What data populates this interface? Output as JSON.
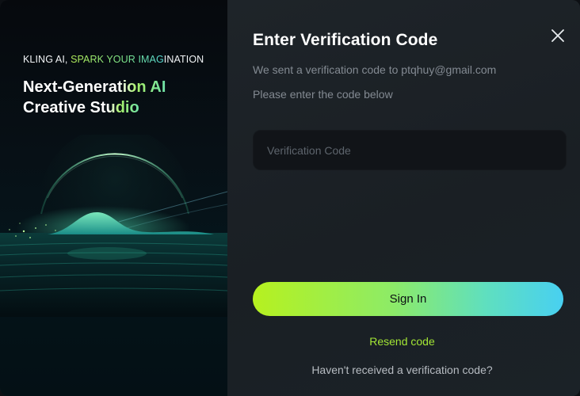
{
  "promo": {
    "tagline_part1": "KLING AI, ",
    "tagline_part2": "SPARK YOUR IMAG",
    "tagline_part3": "INATION",
    "headline_line1_plain": "Next-Gen",
    "headline_line1_grad": "eration AI",
    "headline_line2_plain": "Creative ",
    "headline_line2_grad": "Studio"
  },
  "dialog": {
    "title": "Enter Verification Code",
    "subtitle": "We sent a verification code to ptqhuy@gmail.com",
    "instruction": "Please enter the code below",
    "code_field": {
      "placeholder": "Verification Code",
      "value": ""
    },
    "sign_in_label": "Sign In",
    "resend_label": "Resend code",
    "help_label": "Haven't received a verification code?",
    "close_icon": "close-icon"
  },
  "colors": {
    "accent_green": "#a3e635",
    "gradient_start": "#b6f11f",
    "gradient_end": "#48d0f1",
    "panel_bg": "#1c2126",
    "input_bg": "#111418"
  }
}
